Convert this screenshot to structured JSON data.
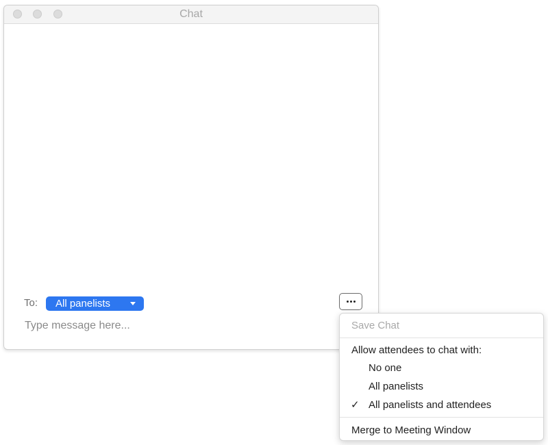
{
  "window": {
    "title": "Chat"
  },
  "composer": {
    "to_label": "To:",
    "recipient": "All panelists",
    "placeholder": "Type message here..."
  },
  "menu": {
    "save_chat": "Save Chat",
    "allow_header": "Allow attendees to chat with:",
    "options": [
      {
        "label": "No one",
        "checked": false
      },
      {
        "label": "All panelists",
        "checked": false
      },
      {
        "label": "All panelists and attendees",
        "checked": true
      }
    ],
    "merge": "Merge to Meeting Window"
  },
  "colors": {
    "accent": "#2d77f0"
  },
  "icons": {
    "more": "ellipsis-icon",
    "dropdown": "caret-down-icon",
    "check": "checkmark-icon"
  }
}
